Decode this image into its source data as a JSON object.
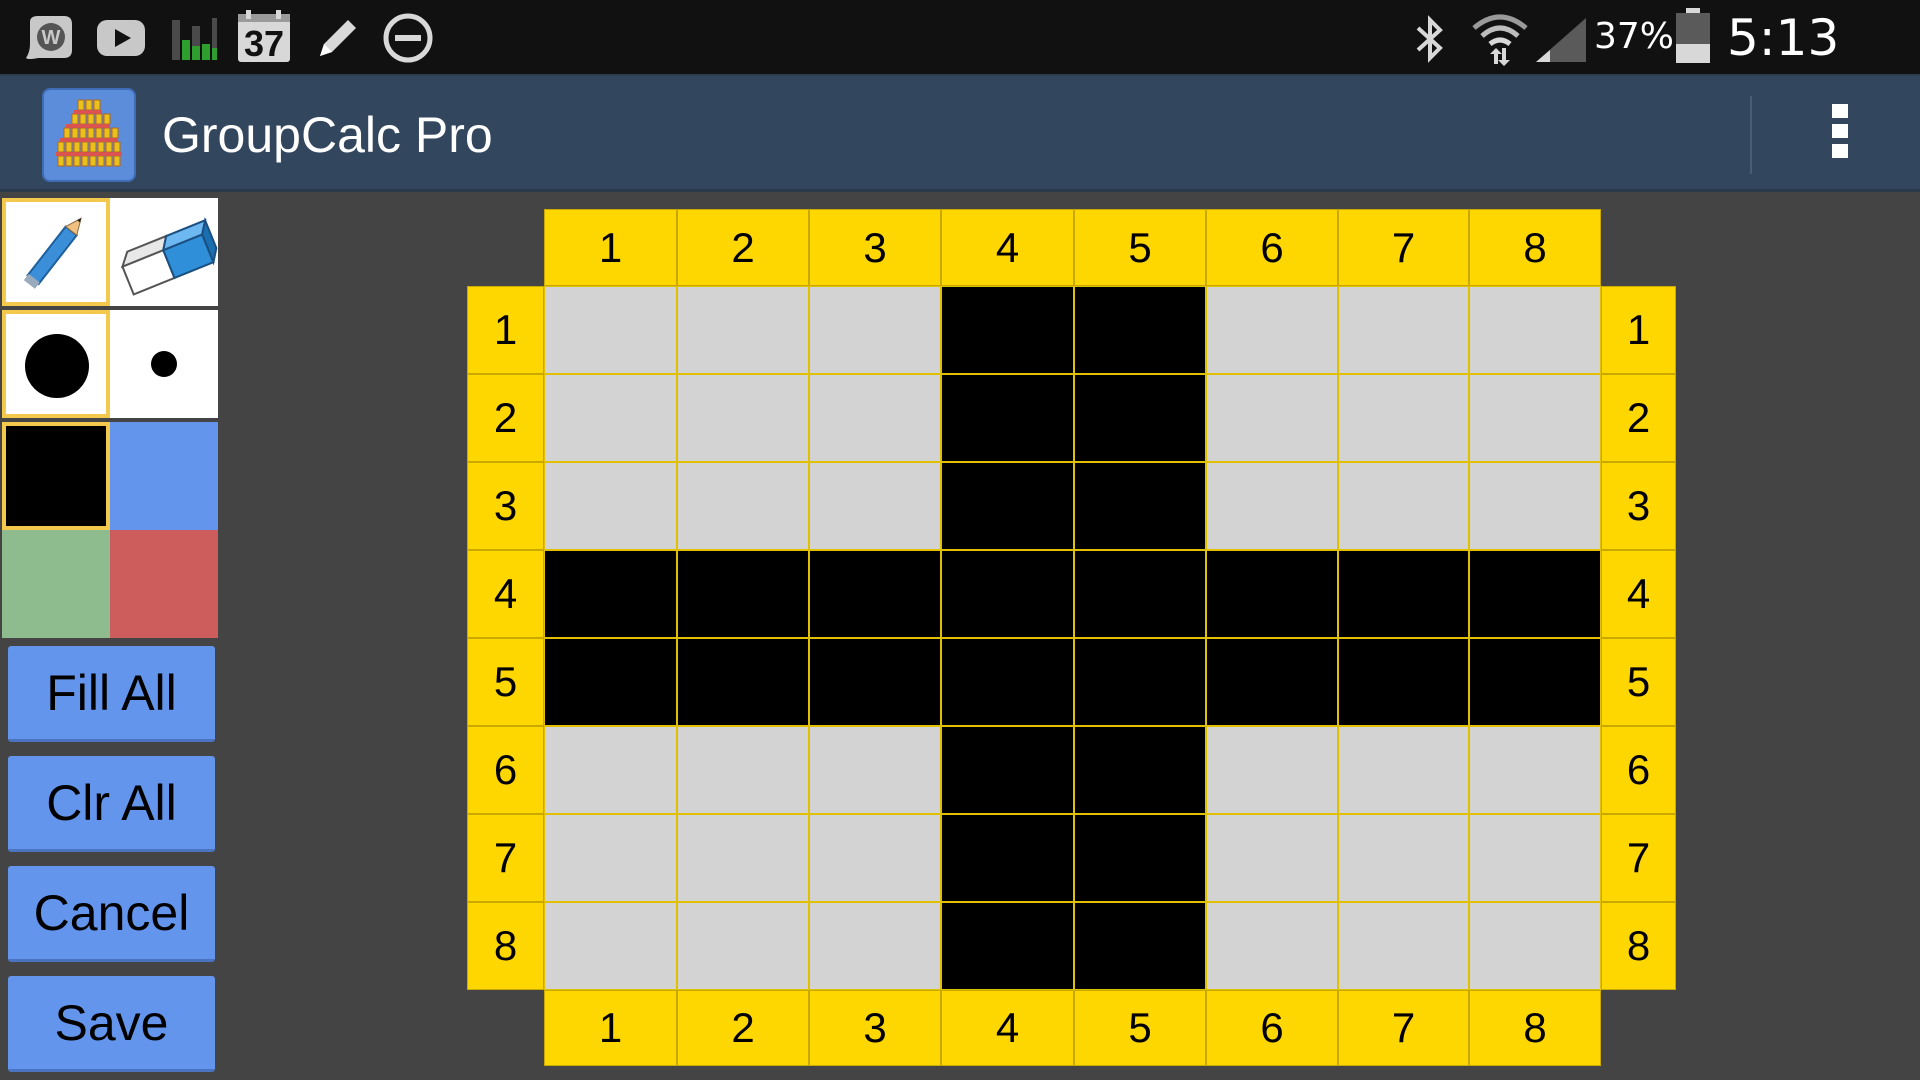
{
  "status_bar": {
    "notification_icons": [
      "wordpress-icon",
      "youtube-icon",
      "bar-chart-icon",
      "calendar-icon",
      "pencil-icon",
      "do-not-disturb-icon"
    ],
    "calendar_day": "37",
    "system_icons": [
      "bluetooth-icon",
      "wifi-icon",
      "cell-signal-icon",
      "battery-icon"
    ],
    "battery_percent": "37%",
    "time": "5:13 PM"
  },
  "action_bar": {
    "app_icon": "groupcalc-app-icon",
    "title": "GroupCalc Pro",
    "menu_icon": "overflow-menu-icon"
  },
  "tools": {
    "draw_modes": [
      {
        "name": "pencil",
        "icon": "pencil-icon",
        "selected": true
      },
      {
        "name": "eraser",
        "icon": "eraser-icon",
        "selected": false
      }
    ],
    "brush_sizes": [
      {
        "name": "large",
        "icon": "large-dot-icon",
        "selected": true
      },
      {
        "name": "small",
        "icon": "small-dot-icon",
        "selected": false
      }
    ],
    "colors": [
      {
        "name": "black",
        "hex": "#000000",
        "selected": true
      },
      {
        "name": "blue",
        "hex": "#6495ed",
        "selected": false
      },
      {
        "name": "green",
        "hex": "#8fbc8f",
        "selected": false
      },
      {
        "name": "red",
        "hex": "#cd5c5c",
        "selected": false
      }
    ]
  },
  "buttons": {
    "fill_all": "Fill All",
    "clr_all": "Clr All",
    "cancel": "Cancel",
    "save": "Save"
  },
  "grid": {
    "column_labels": [
      "1",
      "2",
      "3",
      "4",
      "5",
      "6",
      "7",
      "8"
    ],
    "row_labels": [
      "1",
      "2",
      "3",
      "4",
      "5",
      "6",
      "7",
      "8"
    ],
    "fill_color": "#000000",
    "empty_color": "#d3d3d3",
    "header_color": "#ffd700",
    "cells": [
      [
        0,
        0,
        0,
        1,
        1,
        0,
        0,
        0
      ],
      [
        0,
        0,
        0,
        1,
        1,
        0,
        0,
        0
      ],
      [
        0,
        0,
        0,
        1,
        1,
        0,
        0,
        0
      ],
      [
        1,
        1,
        1,
        1,
        1,
        1,
        1,
        1
      ],
      [
        1,
        1,
        1,
        1,
        1,
        1,
        1,
        1
      ],
      [
        0,
        0,
        0,
        1,
        1,
        0,
        0,
        0
      ],
      [
        0,
        0,
        0,
        1,
        1,
        0,
        0,
        0
      ],
      [
        0,
        0,
        0,
        1,
        1,
        0,
        0,
        0
      ]
    ]
  }
}
